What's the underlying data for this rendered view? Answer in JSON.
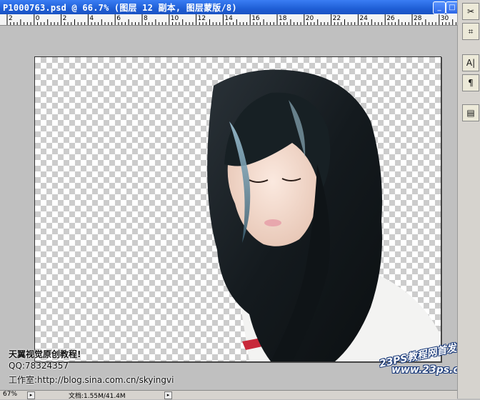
{
  "window": {
    "title": "P1000763.psd @ 66.7% (图层 12 副本, 图层蒙版/8)",
    "minimize_glyph": "_",
    "maximize_glyph": "□"
  },
  "ruler": {
    "labels": [
      "2",
      "0",
      "2",
      "4",
      "6",
      "8",
      "10",
      "12",
      "14",
      "16",
      "18",
      "20",
      "22",
      "24",
      "26",
      "28",
      "30"
    ]
  },
  "watermark": {
    "line1": "天翼视觉原创教程!",
    "line2": "QQ:78324357",
    "line3": "工作室:http://blog.sina.com.cn/skyingvi",
    "site_name": "23PS教程网首发!",
    "site_url": "www.23ps.com"
  },
  "status": {
    "zoom": "67%",
    "doc_info": "文档:1.55M/41.4M"
  },
  "palette": {
    "icons": [
      "toolbox-icon",
      "history-brush-icon",
      "character-icon",
      "paragraph-icon",
      "layer-comps-icon"
    ],
    "glyphs": [
      "✂",
      "⌗",
      "A|",
      "¶",
      "▤"
    ]
  },
  "colors": {
    "titlebar": "#1f5fd6",
    "canvas_bg": "#c0c0c0",
    "checker": "#cccccc"
  }
}
